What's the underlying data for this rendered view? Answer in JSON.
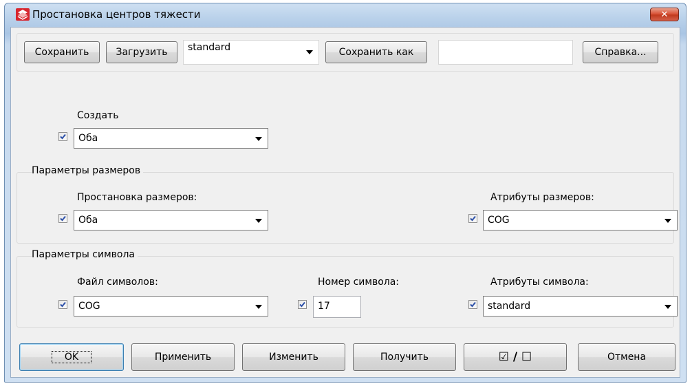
{
  "window": {
    "title": "Простановка центров тяжести",
    "close_label": "✕"
  },
  "toolbar": {
    "save_label": "Сохранить",
    "load_label": "Загрузить",
    "preset_value": "standard",
    "save_as_label": "Сохранить как",
    "save_as_value": "",
    "help_label": "Справка..."
  },
  "create": {
    "label": "Создать",
    "value": "Оба",
    "checked": true
  },
  "dimension_params": {
    "group_label": "Параметры размеров",
    "placement_label": "Простановка размеров:",
    "placement_value": "Оба",
    "attributes_label": "Атрибуты размеров:",
    "attributes_value": "COG"
  },
  "symbol_params": {
    "group_label": "Параметры символа",
    "file_label": "Файл символов:",
    "file_value": "COG",
    "number_label": "Номер символа:",
    "number_value": "17",
    "attributes_label": "Атрибуты символа:",
    "attributes_value": "standard"
  },
  "footer": {
    "ok_label": "OK",
    "apply_label": "Применить",
    "modify_label": "Изменить",
    "get_label": "Получить",
    "toggle_label": "☑ / ☐",
    "cancel_label": "Отмена"
  },
  "colors": {
    "checkmark": "#2b4fa8",
    "title_gradient": "#b9d1ea",
    "close_red": "#c13a1e"
  }
}
